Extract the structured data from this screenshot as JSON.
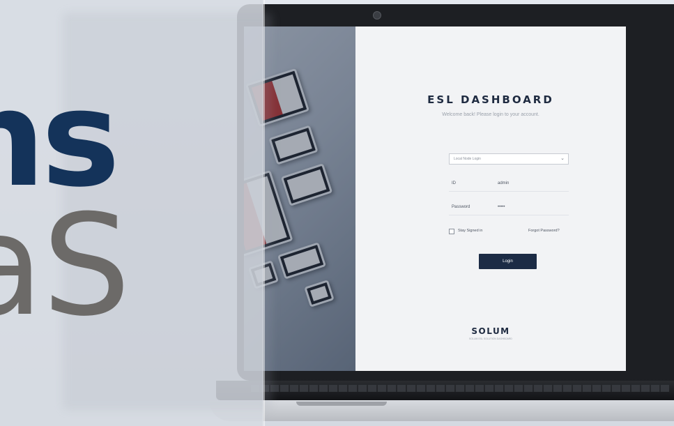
{
  "login": {
    "title": "ESL DASHBOARD",
    "subtitle": "Welcome back! Please login to your account.",
    "login_type": "Local Node Login",
    "id_label": "ID",
    "id_value": "admin",
    "password_label": "Password",
    "password_value": "•••••",
    "stay_signed_in": "Stay Signed in",
    "forgot_password": "Forgot Password?",
    "login_button": "Login"
  },
  "brand": {
    "logo": "SOLUM",
    "tagline": "SOLUM ESL SOLUTION DASHBOARD"
  },
  "overlay_text": {
    "line1": "ns",
    "line2": "aS"
  },
  "colors": {
    "navy": "#1c2b45",
    "overlay_blue": "#14335a",
    "overlay_gray": "#6c6a68"
  }
}
